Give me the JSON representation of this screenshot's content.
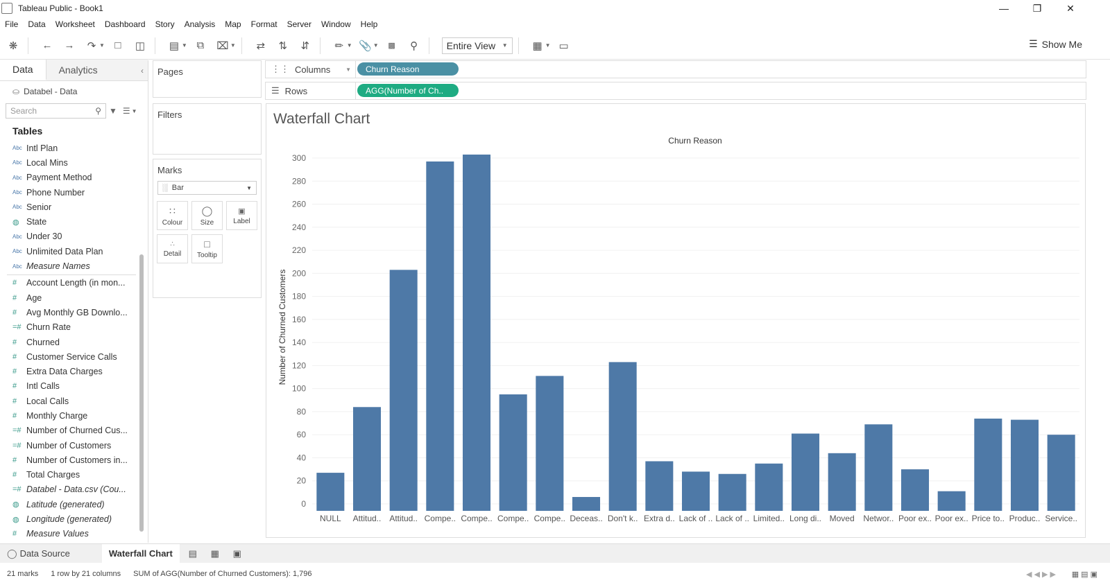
{
  "window": {
    "title": "Tableau Public - Book1"
  },
  "menu": [
    "File",
    "Data",
    "Worksheet",
    "Dashboard",
    "Story",
    "Analysis",
    "Map",
    "Format",
    "Server",
    "Window",
    "Help"
  ],
  "toolbar": {
    "fit": "Entire View",
    "show_me": "Show Me"
  },
  "left": {
    "tab_data": "Data",
    "tab_analytics": "Analytics",
    "datasource": "Databel - Data",
    "search_placeholder": "Search",
    "tables_header": "Tables",
    "dimensions": [
      {
        "name": "Intl Plan",
        "type": "Abc"
      },
      {
        "name": "Local Mins",
        "type": "Abc"
      },
      {
        "name": "Payment Method",
        "type": "Abc"
      },
      {
        "name": "Phone Number",
        "type": "Abc"
      },
      {
        "name": "Senior",
        "type": "Abc"
      },
      {
        "name": "State",
        "type": "geo"
      },
      {
        "name": "Under 30",
        "type": "Abc"
      },
      {
        "name": "Unlimited Data Plan",
        "type": "Abc"
      },
      {
        "name": "Measure Names",
        "type": "Abc",
        "italic": true
      }
    ],
    "measures": [
      {
        "name": "Account Length (in mon...",
        "type": "#"
      },
      {
        "name": "Age",
        "type": "#"
      },
      {
        "name": "Avg Monthly GB Downlo...",
        "type": "#"
      },
      {
        "name": "Churn Rate",
        "type": "=#"
      },
      {
        "name": "Churned",
        "type": "#"
      },
      {
        "name": "Customer Service Calls",
        "type": "#"
      },
      {
        "name": "Extra Data Charges",
        "type": "#"
      },
      {
        "name": "Intl Calls",
        "type": "#"
      },
      {
        "name": "Local Calls",
        "type": "#"
      },
      {
        "name": "Monthly Charge",
        "type": "#"
      },
      {
        "name": "Number of Churned Cus...",
        "type": "=#"
      },
      {
        "name": "Number of Customers",
        "type": "=#"
      },
      {
        "name": "Number of Customers in...",
        "type": "#"
      },
      {
        "name": "Total Charges",
        "type": "#"
      },
      {
        "name": "Databel - Data.csv (Cou...",
        "type": "=#",
        "italic": true
      },
      {
        "name": "Latitude (generated)",
        "type": "geo",
        "italic": true
      },
      {
        "name": "Longitude (generated)",
        "type": "geo",
        "italic": true
      },
      {
        "name": "Measure Values",
        "type": "#",
        "italic": true
      }
    ]
  },
  "cards": {
    "pages": "Pages",
    "filters": "Filters",
    "marks": "Marks",
    "mark_type": "Bar",
    "buttons": [
      "Colour",
      "Size",
      "Label",
      "Detail",
      "Tooltip"
    ]
  },
  "shelves": {
    "columns_label": "Columns",
    "rows_label": "Rows",
    "columns_pill": "Churn Reason",
    "rows_pill": "AGG(Number of Ch..",
    "columns_color": "#4a90a4",
    "rows_color": "#1eab82"
  },
  "chart_data": {
    "type": "bar",
    "title": "Waterfall Chart",
    "xlabel": "Churn Reason",
    "ylabel": "Number of Churned Customers",
    "ylim": [
      0,
      300
    ],
    "yticks": [
      0,
      20,
      40,
      60,
      80,
      100,
      120,
      140,
      160,
      180,
      200,
      220,
      240,
      260,
      280,
      300
    ],
    "categories": [
      "NULL",
      "Attitud..",
      "Attitud..",
      "Compe..",
      "Compe..",
      "Compe..",
      "Compe..",
      "Deceas..",
      "Don't k..",
      "Extra d..",
      "Lack of ..",
      "Lack of ..",
      "Limited..",
      "Long di..",
      "Moved",
      "Networ..",
      "Poor ex..",
      "Poor ex..",
      "Price to..",
      "Produc..",
      "Service.."
    ],
    "values": [
      27,
      84,
      203,
      297,
      303,
      95,
      111,
      6,
      123,
      37,
      28,
      26,
      35,
      61,
      44,
      69,
      30,
      11,
      74,
      73,
      60
    ],
    "bar_color": "#4e79a7"
  },
  "bottom": {
    "data_source_tab": "Data Source",
    "sheet_tab": "Waterfall Chart"
  },
  "status": {
    "marks": "21 marks",
    "dims": "1 row by 21 columns",
    "sum": "SUM of AGG(Number of Churned Customers): 1,796"
  }
}
